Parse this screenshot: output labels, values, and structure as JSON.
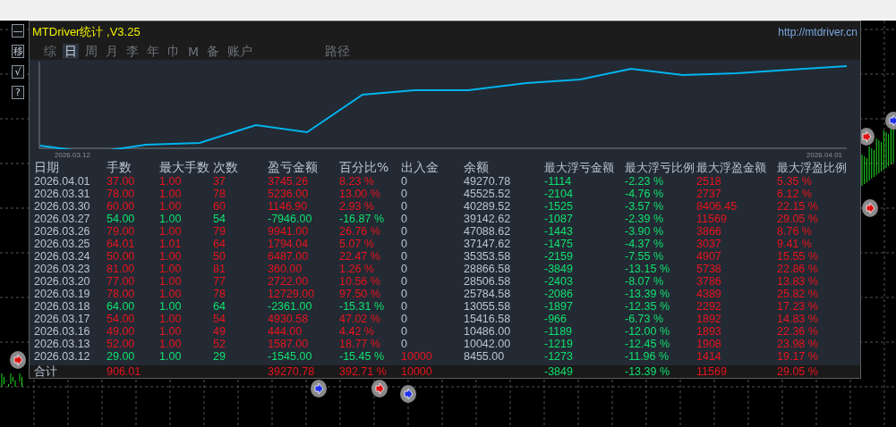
{
  "side_buttons": [
    "—",
    "移",
    "√",
    "?"
  ],
  "panel": {
    "title": "MTDriver统计 ,V3.25",
    "url": "http://mtdriver.cn",
    "tabs": [
      {
        "label": "综",
        "selected": false
      },
      {
        "label": "日",
        "selected": true
      },
      {
        "label": "周",
        "selected": false
      },
      {
        "label": "月",
        "selected": false
      },
      {
        "label": "李",
        "selected": false
      },
      {
        "label": "年",
        "selected": false
      },
      {
        "label": "巾",
        "selected": false
      },
      {
        "label": "M",
        "selected": false
      },
      {
        "label": "备",
        "selected": false
      },
      {
        "label": "账户",
        "selected": false
      }
    ],
    "path_button": "路径",
    "chart": {
      "start_label": "2026.03.12",
      "end_label": "2026.04.01"
    },
    "table": {
      "columns": [
        "日期",
        "手数",
        "最大手数",
        "次数",
        "盈亏金额",
        "百分比%",
        "出入金",
        "余额",
        "最大浮亏金额",
        "最大浮亏比例",
        "最大浮盈金额",
        "最大浮盈比例"
      ],
      "rows": [
        {
          "cells": [
            "2026.04.01",
            "37.00",
            "1.00",
            "37",
            "3745.26",
            "8.23 %",
            "0",
            "49270.78",
            "-1114",
            "-2.23 %",
            "2518",
            "5.35 %"
          ],
          "loss": false,
          "deposit_flagged": false
        },
        {
          "cells": [
            "2026.03.31",
            "78.00",
            "1.00",
            "78",
            "5236.00",
            "13.00 %",
            "0",
            "45525.52",
            "-2104",
            "-4.76 %",
            "2737",
            "6.12 %"
          ],
          "loss": false,
          "deposit_flagged": false
        },
        {
          "cells": [
            "2026.03.30",
            "60.00",
            "1.00",
            "60",
            "1146.90",
            "2.93 %",
            "0",
            "40289.52",
            "-1525",
            "-3.57 %",
            "8406.45",
            "22.15 %"
          ],
          "loss": false,
          "deposit_flagged": false
        },
        {
          "cells": [
            "2026.03.27",
            "54.00",
            "1.00",
            "54",
            "-7946.00",
            "-16.87 %",
            "0",
            "39142.62",
            "-1087",
            "-2.39 %",
            "11569",
            "29.05 %"
          ],
          "loss": true,
          "deposit_flagged": false
        },
        {
          "cells": [
            "2026.03.26",
            "79.00",
            "1.00",
            "79",
            "9941.00",
            "26.76 %",
            "0",
            "47088.62",
            "-1443",
            "-3.90 %",
            "3866",
            "8.76 %"
          ],
          "loss": false,
          "deposit_flagged": false
        },
        {
          "cells": [
            "2026.03.25",
            "64.01",
            "1.01",
            "64",
            "1794.04",
            "5.07 %",
            "0",
            "37147.62",
            "-1475",
            "-4.37 %",
            "3037",
            "9.41 %"
          ],
          "loss": false,
          "deposit_flagged": false
        },
        {
          "cells": [
            "2026.03.24",
            "50.00",
            "1.00",
            "50",
            "6487.00",
            "22.47 %",
            "0",
            "35353.58",
            "-2159",
            "-7.55 %",
            "4907",
            "15.55 %"
          ],
          "loss": false,
          "deposit_flagged": false
        },
        {
          "cells": [
            "2026.03.23",
            "81.00",
            "1.00",
            "81",
            "360.00",
            "1.26 %",
            "0",
            "28866.58",
            "-3849",
            "-13.15 %",
            "5738",
            "22.86 %"
          ],
          "loss": false,
          "deposit_flagged": false
        },
        {
          "cells": [
            "2026.03.20",
            "77.00",
            "1.00",
            "77",
            "2722.00",
            "10.56 %",
            "0",
            "28506.58",
            "-2403",
            "-8.07 %",
            "3786",
            "13.83 %"
          ],
          "loss": false,
          "deposit_flagged": false
        },
        {
          "cells": [
            "2026.03.19",
            "78.00",
            "1.00",
            "78",
            "12729.00",
            "97.50 %",
            "0",
            "25784.58",
            "-2086",
            "-13.39 %",
            "4389",
            "25.82 %"
          ],
          "loss": false,
          "deposit_flagged": false
        },
        {
          "cells": [
            "2026.03.18",
            "64.00",
            "1.00",
            "64",
            "-2361.00",
            "-15.31 %",
            "0",
            "13055.58",
            "-1897",
            "-12.35 %",
            "2292",
            "17.23 %"
          ],
          "loss": true,
          "deposit_flagged": false
        },
        {
          "cells": [
            "2026.03.17",
            "54.00",
            "1.00",
            "54",
            "4930.58",
            "47.02 %",
            "0",
            "15416.58",
            "-966",
            "-6.73 %",
            "1892",
            "14.83 %"
          ],
          "loss": false,
          "deposit_flagged": false
        },
        {
          "cells": [
            "2026.03.16",
            "49.00",
            "1.00",
            "49",
            "444.00",
            "4.42 %",
            "0",
            "10486.00",
            "-1189",
            "-12.00 %",
            "1893",
            "22.36 %"
          ],
          "loss": false,
          "deposit_flagged": false
        },
        {
          "cells": [
            "2026.03.13",
            "52.00",
            "1.00",
            "52",
            "1587.00",
            "18.77 %",
            "0",
            "10042.00",
            "-1219",
            "-12.45 %",
            "1908",
            "23.98 %"
          ],
          "loss": false,
          "deposit_flagged": false
        },
        {
          "cells": [
            "2026.03.12",
            "29.00",
            "1.00",
            "29",
            "-1545.00",
            "-15.45 %",
            "10000",
            "8455.00",
            "-1273",
            "-11.96 %",
            "1414",
            "19.17 %"
          ],
          "loss": true,
          "deposit_flagged": true
        }
      ],
      "total": {
        "label": "合计",
        "lots": "906.01",
        "pnl": "39270.78",
        "pct": "392.71 %",
        "deposit": "10000",
        "max_float_loss": "-3849",
        "max_float_loss_pct": "-13.39 %",
        "max_float_profit": "11569",
        "max_float_profit_pct": "29.05 %"
      }
    }
  }
}
